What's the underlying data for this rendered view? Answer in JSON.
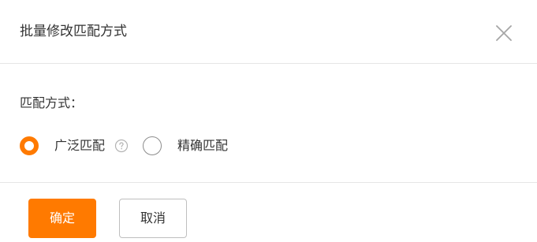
{
  "dialog": {
    "title": "批量修改匹配方式",
    "close_icon": "close-icon"
  },
  "form": {
    "match_label": "匹配方式：",
    "options": [
      {
        "label": "广泛匹配",
        "checked": true,
        "help_icon": "question-circle-icon"
      },
      {
        "label": "精确匹配",
        "checked": false
      }
    ]
  },
  "footer": {
    "confirm_label": "确定",
    "cancel_label": "取消"
  },
  "colors": {
    "accent": "#ff7a00",
    "divider": "#e6e6e6",
    "text": "#333333"
  }
}
